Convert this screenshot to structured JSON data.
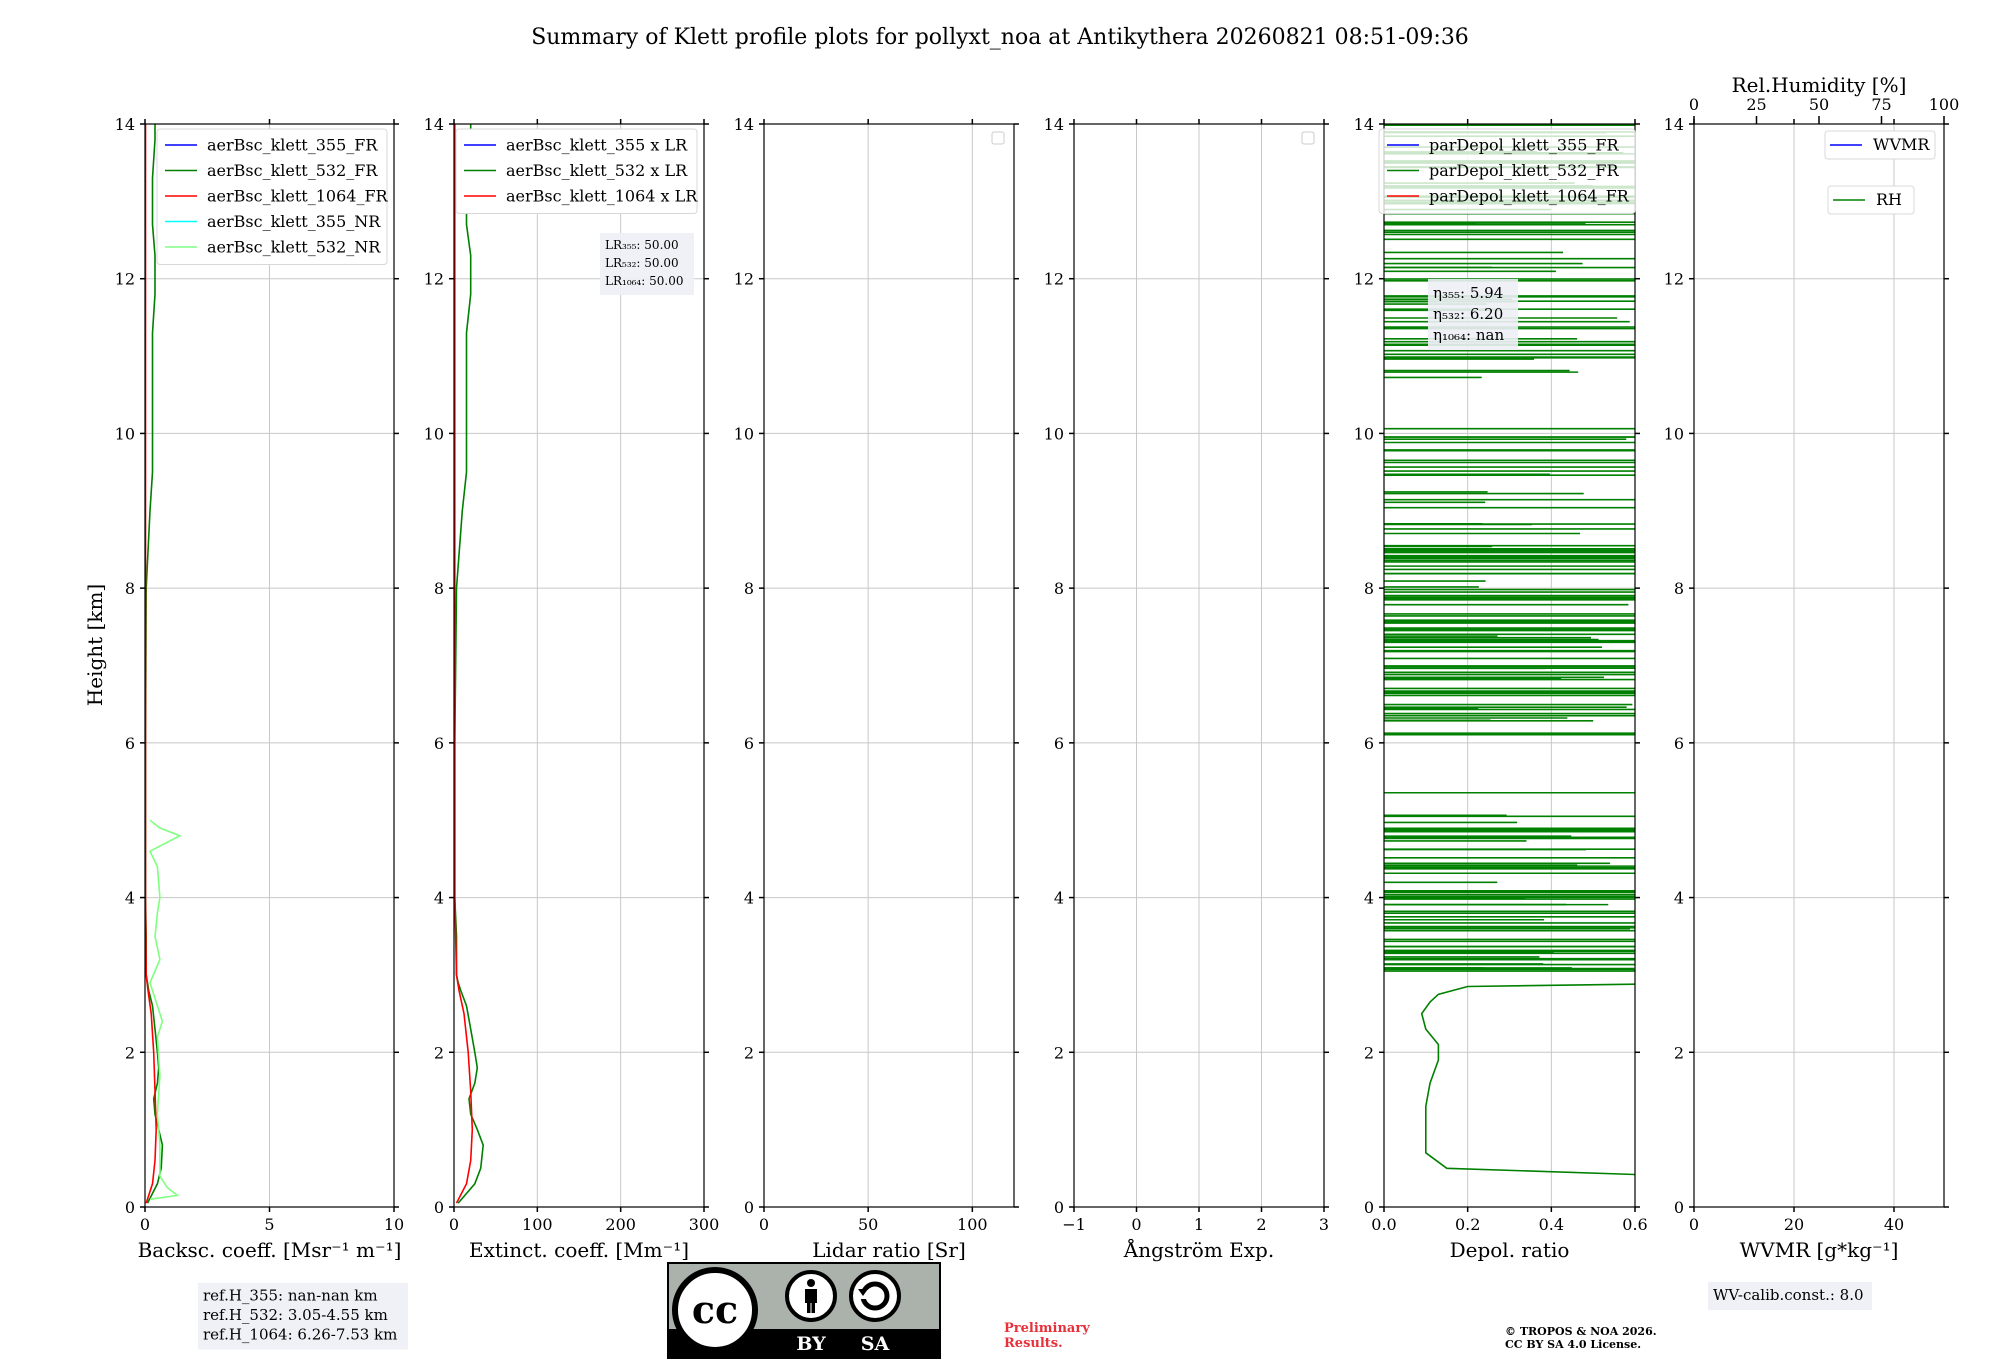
{
  "title": "Summary of Klett profile plots for pollyxt_noa at Antikythera 20260821 08:51-09:36",
  "y_axis_label": "Height [km]",
  "colors": {
    "ch355": "#0000ff",
    "ch532": "#008000",
    "ch1064": "#ff0000",
    "ch355_nr": "#00ffff",
    "ch532_nr": "#80ff80"
  },
  "chart_data": [
    {
      "type": "line",
      "xlabel": "Backsc. coeff. [Msr⁻¹ m⁻¹]",
      "xlim": [
        0,
        10
      ],
      "xticks": [
        "0",
        "5",
        "10"
      ],
      "ylim": [
        0,
        14
      ],
      "yticks": [
        "0",
        "2",
        "4",
        "6",
        "8",
        "10",
        "12",
        "14"
      ],
      "grid": true,
      "legend": "top-right",
      "series": [
        {
          "name": "aerBsc_klett_355_FR",
          "color": "#0000ff",
          "y": [],
          "x": []
        },
        {
          "name": "aerBsc_klett_532_FR",
          "color": "#008000",
          "y": [
            0.05,
            0.3,
            0.5,
            0.8,
            1.0,
            1.2,
            1.4,
            1.6,
            1.8,
            2.0,
            2.3,
            2.6,
            2.8,
            2.9,
            3.0,
            3.5,
            4.0,
            5.0,
            6.0,
            8.0,
            9.0,
            9.5,
            10.8,
            11.3,
            11.8,
            12.3,
            12.7,
            13.3,
            13.8,
            14.0
          ],
          "x": [
            0.1,
            0.5,
            0.65,
            0.7,
            0.55,
            0.4,
            0.35,
            0.5,
            0.55,
            0.5,
            0.4,
            0.3,
            0.15,
            0.1,
            0.05,
            0.05,
            0.02,
            0.02,
            0.02,
            0.05,
            0.2,
            0.3,
            0.3,
            0.3,
            0.4,
            0.4,
            0.3,
            0.3,
            0.4,
            0.4
          ]
        },
        {
          "name": "aerBsc_klett_1064_FR",
          "color": "#ff0000",
          "y": [
            0.05,
            0.3,
            0.6,
            1.0,
            1.5,
            2.0,
            2.5,
            2.8,
            3.0,
            4.0,
            6.0,
            8.0,
            10.0,
            12.0,
            14.0
          ],
          "x": [
            0.05,
            0.3,
            0.4,
            0.45,
            0.4,
            0.35,
            0.25,
            0.12,
            0.05,
            0.02,
            0.02,
            0.02,
            0.02,
            0.02,
            0.02
          ]
        },
        {
          "name": "aerBsc_klett_355_NR",
          "color": "#00ffff",
          "y": [],
          "x": []
        },
        {
          "name": "aerBsc_klett_532_NR",
          "color": "#80ff80",
          "y": [
            0.1,
            0.15,
            0.25,
            0.4,
            0.8,
            1.2,
            1.7,
            2.2,
            2.4,
            2.6,
            2.9,
            3.2,
            3.5,
            3.8,
            4.0,
            4.4,
            4.6,
            4.8,
            4.9,
            5.0
          ],
          "x": [
            0.2,
            1.3,
            0.9,
            0.6,
            0.6,
            0.5,
            0.6,
            0.5,
            0.7,
            0.5,
            0.2,
            0.6,
            0.4,
            0.5,
            0.6,
            0.5,
            0.2,
            1.4,
            0.6,
            0.2
          ]
        }
      ],
      "info_box": [
        "ref.H_355: nan-nan km",
        "ref.H_532: 3.05-4.55 km",
        "ref.H_1064: 6.26-7.53 km"
      ]
    },
    {
      "type": "line",
      "xlabel": "Extinct. coeff. [Mm⁻¹]",
      "xlim": [
        0,
        300
      ],
      "xticks": [
        "0",
        "100",
        "200",
        "300"
      ],
      "ylim": [
        0,
        14
      ],
      "yticks": [
        "0",
        "2",
        "4",
        "6",
        "8",
        "10",
        "12",
        "14"
      ],
      "grid": true,
      "legend": "top-right",
      "series": [
        {
          "name": "aerBsc_klett_355 x LR",
          "color": "#0000ff",
          "y": [],
          "x": []
        },
        {
          "name": "aerBsc_klett_532 x LR",
          "color": "#008000",
          "y": [
            0.05,
            0.3,
            0.5,
            0.8,
            1.0,
            1.2,
            1.4,
            1.6,
            1.8,
            2.0,
            2.3,
            2.6,
            2.8,
            2.9,
            3.0,
            3.5,
            4.0,
            5.0,
            6.0,
            8.0,
            9.0,
            9.5,
            10.8,
            11.3,
            11.8,
            12.3,
            12.7,
            13.3,
            13.8,
            14.0
          ],
          "x": [
            5,
            25,
            32,
            35,
            28,
            20,
            18,
            25,
            28,
            25,
            20,
            15,
            8,
            5,
            3,
            3,
            1,
            1,
            1,
            3,
            10,
            15,
            15,
            15,
            20,
            20,
            15,
            15,
            20,
            20
          ]
        },
        {
          "name": "aerBsc_klett_1064 x LR",
          "color": "#ff0000",
          "y": [
            0.05,
            0.3,
            0.6,
            1.0,
            1.5,
            2.0,
            2.5,
            2.8,
            3.0,
            4.0,
            6.0,
            8.0,
            10.0,
            12.0,
            14.0
          ],
          "x": [
            3,
            15,
            20,
            22,
            20,
            17,
            12,
            6,
            3,
            1,
            1,
            1,
            1,
            1,
            1
          ]
        }
      ],
      "info_box": [
        "LR₃₅₅: 50.00",
        "LR₅₃₂: 50.00",
        "LR₁₀₆₄: 50.00"
      ]
    },
    {
      "type": "line",
      "xlabel": "Lidar ratio [Sr]",
      "xlim": [
        0,
        120
      ],
      "xticks": [
        "0",
        "50",
        "100"
      ],
      "ylim": [
        0,
        14
      ],
      "yticks": [
        "0",
        "2",
        "4",
        "6",
        "8",
        "10",
        "12",
        "14"
      ],
      "grid": true,
      "legend": "top-right",
      "series": []
    },
    {
      "type": "line",
      "xlabel": "Ångström Exp.",
      "xlim": [
        -1,
        3
      ],
      "xticks": [
        "−1",
        "0",
        "1",
        "2",
        "3"
      ],
      "ylim": [
        0,
        14
      ],
      "yticks": [
        "0",
        "2",
        "4",
        "6",
        "8",
        "10",
        "12",
        "14"
      ],
      "grid": true,
      "legend": "top-right",
      "series": []
    },
    {
      "type": "line",
      "xlabel": "Depol. ratio",
      "xlim": [
        0,
        0.6
      ],
      "xticks": [
        "0.0",
        "0.2",
        "0.4",
        "0.6"
      ],
      "ylim": [
        0,
        14
      ],
      "yticks": [
        "0",
        "2",
        "4",
        "6",
        "8",
        "10",
        "12",
        "14"
      ],
      "grid": true,
      "legend": "top-left",
      "series": [
        {
          "name": "parDepol_klett_355_FR",
          "color": "#0000ff",
          "y": [],
          "x": []
        },
        {
          "name": "parDepol_klett_532_FR",
          "color": "#008000",
          "y": [
            0.42,
            0.5,
            0.7,
            1.0,
            1.3,
            1.6,
            1.9,
            2.1,
            2.3,
            2.5,
            2.65,
            2.75,
            2.85,
            2.88
          ],
          "x": [
            0.6,
            0.15,
            0.1,
            0.1,
            0.1,
            0.11,
            0.13,
            0.13,
            0.1,
            0.09,
            0.11,
            0.13,
            0.2,
            0.6
          ]
        },
        {
          "name": "parDepol_klett_1064_FR",
          "color": "#ff0000",
          "y": [],
          "x": []
        }
      ],
      "info_box": [
        "η₃₅₅: 5.94",
        "η₅₃₂: 6.20",
        "η₁₀₆₄: nan"
      ]
    },
    {
      "type": "line",
      "xlabel": "WVMR [g*kg⁻¹]",
      "xlim": [
        0,
        50
      ],
      "xticks": [
        "0",
        "20",
        "40"
      ],
      "top_xlabel": "Rel.Humidity [%]",
      "top_xlim": [
        0,
        100
      ],
      "top_xticks": [
        "0",
        "25",
        "50",
        "75",
        "100"
      ],
      "ylim": [
        0,
        14
      ],
      "yticks": [
        "0",
        "2",
        "4",
        "6",
        "8",
        "10",
        "12",
        "14"
      ],
      "grid": true,
      "legend": "top-right",
      "series": [
        {
          "name": "WVMR",
          "color": "#0000ff",
          "y": [],
          "x": []
        },
        {
          "name": "RH",
          "color": "#008000",
          "y": [],
          "x": []
        }
      ],
      "info_box": [
        "WV-calib.const.: 8.0"
      ]
    }
  ],
  "footer": {
    "preliminary": [
      "Preliminary",
      "Results."
    ],
    "copyright": [
      "© TROPOS & NOA 2026.",
      "CC BY SA 4.0 License."
    ],
    "license_badge": [
      "cc",
      "BY",
      "SA"
    ]
  }
}
